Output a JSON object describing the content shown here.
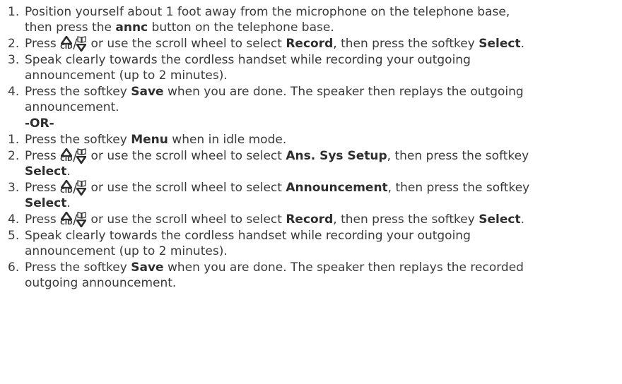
{
  "icon_name": "cid-up-phonebook-down-keys",
  "icon_text": {
    "cid": "CID",
    "slash": "/"
  },
  "section1": [
    {
      "num": "1.",
      "l1a": "Position yourself about 1 foot away from the microphone on the telephone base,",
      "l2a": "then press the ",
      "l2b": "annc",
      "l2c": " button on the telephone base."
    },
    {
      "num": "2.",
      "a": "Press ",
      "b": " or use the scroll wheel to select ",
      "c": "Record",
      "d": ", then press the softkey ",
      "e": "Select",
      "f": "."
    },
    {
      "num": "3.",
      "l1": "Speak clearly towards the cordless handset while recording your outgoing",
      "l2": "announcement (up to 2 minutes)."
    },
    {
      "num": "4.",
      "a": "Press the softkey ",
      "b": "Save",
      "c": " when you are done. The speaker then replays the outgoing",
      "l2": "announcement."
    }
  ],
  "or_text": "-OR-",
  "section2": [
    {
      "num": "1.",
      "a": "Press the softkey ",
      "b": "Menu",
      "c": " when in idle mode."
    },
    {
      "num": "2.",
      "a": "Press ",
      "b": " or use the scroll wheel to select ",
      "c": "Ans. Sys Setup",
      "d": ", then press the softkey",
      "l2": "Select",
      "l2b": "."
    },
    {
      "num": "3.",
      "a": "Press ",
      "b": " or use the scroll wheel to select ",
      "c": "Announcement",
      "d": ", then press the softkey",
      "l2": "Select",
      "l2b": "."
    },
    {
      "num": "4.",
      "a": "Press ",
      "b": " or use the scroll wheel to select ",
      "c": "Record",
      "d": ", then press the softkey ",
      "e": "Select",
      "f": "."
    },
    {
      "num": "5.",
      "l1": "Speak clearly towards the cordless handset while recording your outgoing",
      "l2": "announcement (up to 2 minutes)."
    },
    {
      "num": "6.",
      "a": "Press the softkey ",
      "b": "Save",
      "c": " when you are done. The speaker then replays the recorded",
      "l2": "outgoing announcement."
    }
  ]
}
